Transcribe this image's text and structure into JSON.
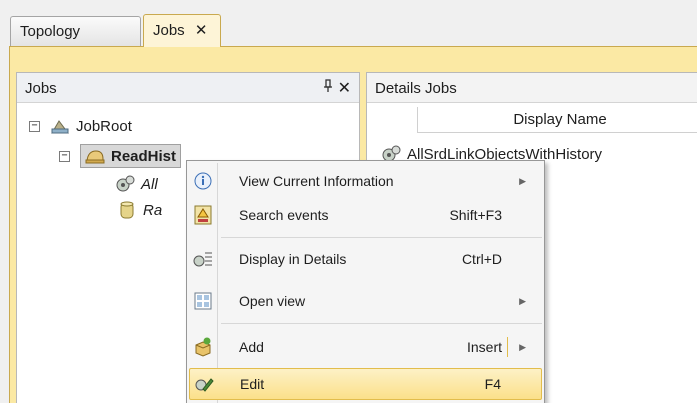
{
  "tabs": [
    {
      "label": "Topology"
    },
    {
      "label": "Jobs"
    }
  ],
  "tab_close_glyph": "✕",
  "left_panel": {
    "title": "Jobs",
    "tree": {
      "root": "JobRoot",
      "selected": "ReadHist",
      "child1": "All",
      "child2": "Ra"
    }
  },
  "right_panel": {
    "title": "Details Jobs",
    "column_header": "Display Name",
    "rows": [
      "AllSrdLinkObjectsWithHistory"
    ]
  },
  "context_menu": {
    "items": [
      {
        "label": "View Current Information",
        "shortcut": "",
        "submenu": true,
        "icon": "info-icon"
      },
      {
        "label": "Search events",
        "shortcut": "Shift+F3",
        "submenu": false,
        "icon": "search-events-icon"
      },
      {
        "label": "Display in Details",
        "shortcut": "Ctrl+D",
        "submenu": false,
        "icon": "details-icon"
      },
      {
        "label": "Open view",
        "shortcut": "",
        "submenu": true,
        "icon": "grid-view-icon"
      },
      {
        "label": "Add",
        "shortcut": "Insert",
        "submenu": true,
        "icon": "add-box-icon"
      },
      {
        "label": "Edit",
        "shortcut": "F4",
        "submenu": false,
        "icon": "edit-icon"
      }
    ]
  },
  "colors": {
    "accent_frame": "#fbe9a4",
    "highlight": "#fbe08a"
  }
}
